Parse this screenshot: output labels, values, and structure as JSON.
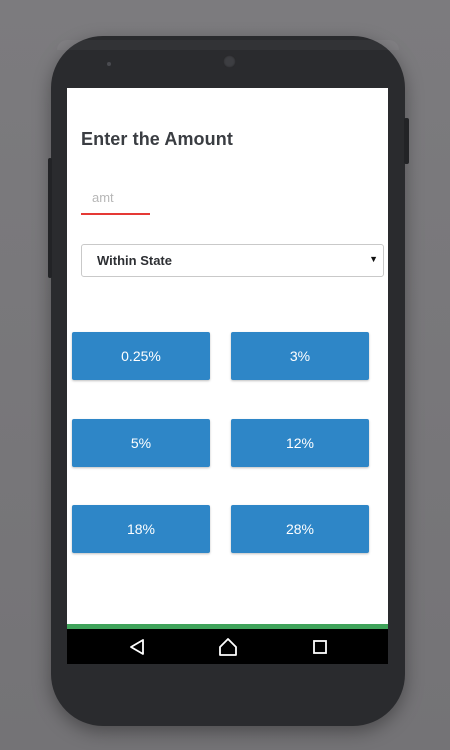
{
  "form": {
    "title": "Enter the Amount",
    "amount_placeholder": "amt",
    "amount_value": "",
    "region_select": {
      "selected": "Within State"
    }
  },
  "rates": [
    {
      "label": "0.25%"
    },
    {
      "label": "3%"
    },
    {
      "label": "5%"
    },
    {
      "label": "12%"
    },
    {
      "label": "18%"
    },
    {
      "label": "28%"
    }
  ],
  "colors": {
    "button": "#2e86c7",
    "input_underline": "#e53935",
    "bottom_strip": "#3fa35a"
  },
  "nav_icons": [
    "back-icon",
    "home-icon",
    "recents-icon"
  ]
}
